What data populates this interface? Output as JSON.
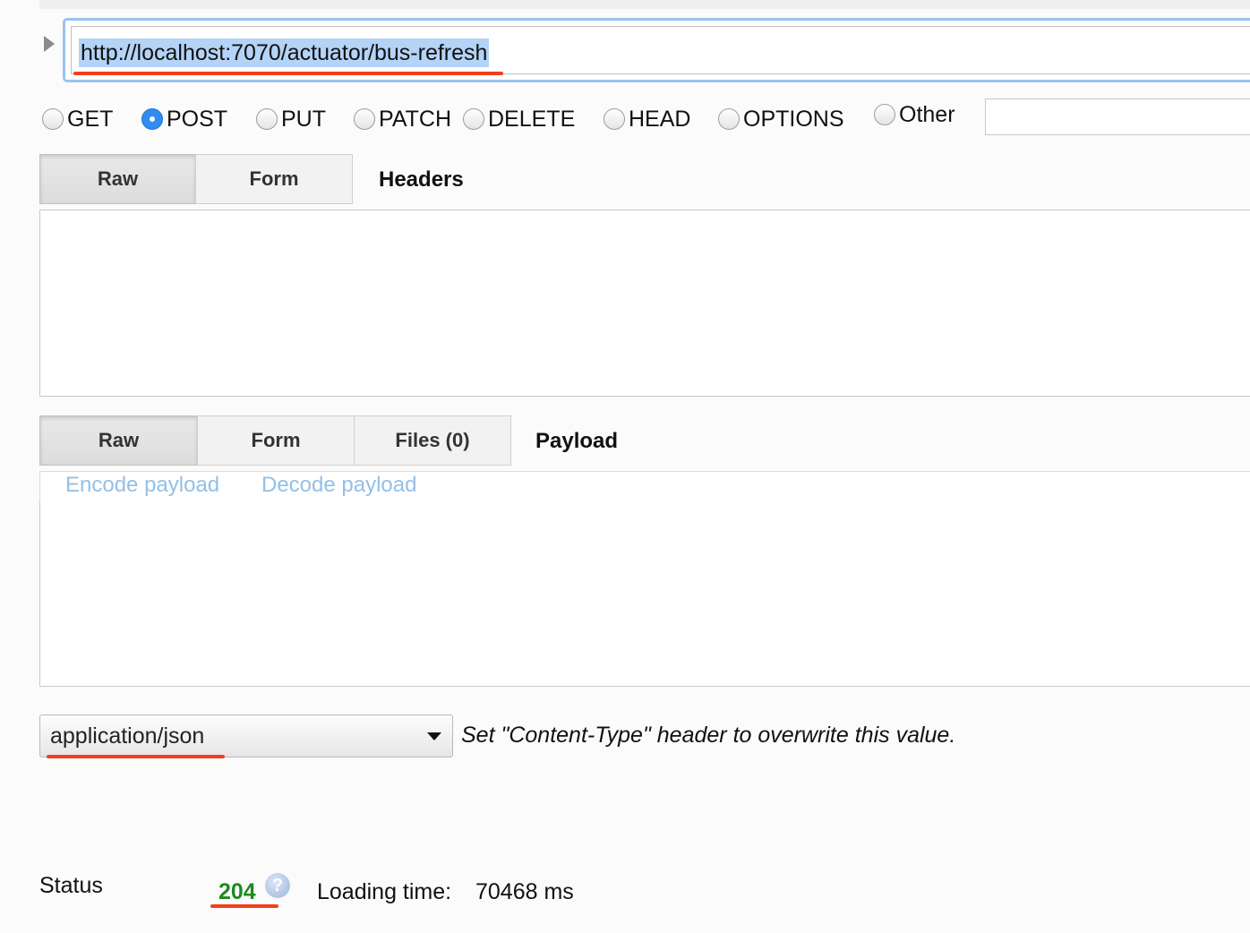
{
  "request": {
    "url": "http://localhost:7070/actuator/bus-refresh",
    "methods": [
      {
        "label": "GET",
        "checked": false
      },
      {
        "label": "POST",
        "checked": true
      },
      {
        "label": "PUT",
        "checked": false
      },
      {
        "label": "PATCH",
        "checked": false
      },
      {
        "label": "DELETE",
        "checked": false
      },
      {
        "label": "HEAD",
        "checked": false
      },
      {
        "label": "OPTIONS",
        "checked": false
      },
      {
        "label": "Other",
        "checked": false
      }
    ],
    "other_value": ""
  },
  "headers": {
    "tabs": [
      {
        "label": "Raw",
        "active": true
      },
      {
        "label": "Form",
        "active": false
      }
    ],
    "title": "Headers",
    "value": ""
  },
  "payload": {
    "tabs": [
      {
        "label": "Raw",
        "active": true
      },
      {
        "label": "Form",
        "active": false
      },
      {
        "label": "Files (0)",
        "active": false
      }
    ],
    "title": "Payload",
    "encode_label": "Encode payload",
    "decode_label": "Decode payload",
    "value": ""
  },
  "content_type": {
    "selected": "application/json",
    "hint": "Set \"Content-Type\" header to overwrite this value."
  },
  "response": {
    "status_label": "Status",
    "status_code": "204",
    "help_icon": "question-icon",
    "loading_label": "Loading time:",
    "loading_value": "70468 ms"
  },
  "colors": {
    "annotation_underline": "#f0401a",
    "status_ok": "#1f8a1f",
    "link": "#94c0e6",
    "radio_checked": "#2f8cf0"
  }
}
